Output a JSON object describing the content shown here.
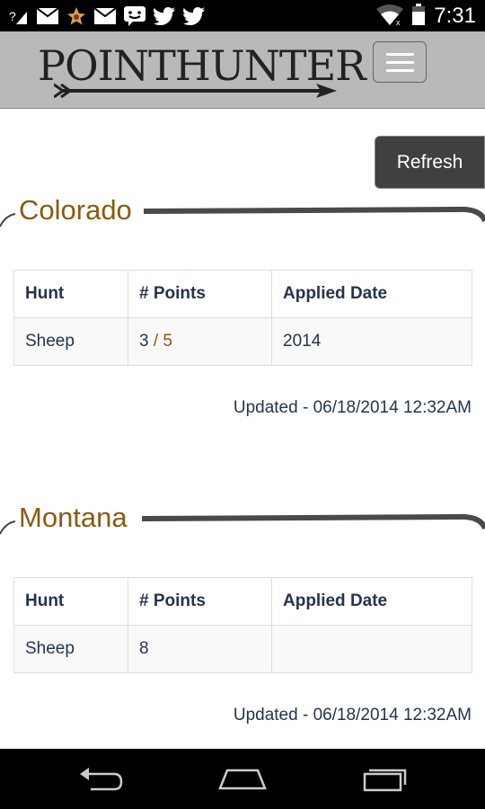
{
  "status_bar": {
    "time": "7:31",
    "left_icons": [
      "unknown-notification-icon",
      "email-icon",
      "star-badge-icon",
      "email-icon",
      "messaging-icon",
      "twitter-icon",
      "twitter-icon"
    ],
    "right_icons": [
      "wifi-icon",
      "battery-icon"
    ]
  },
  "header": {
    "logo_text": "POINTHUNTER",
    "menu_icon": "hamburger-icon"
  },
  "toolbar": {
    "refresh_label": "Refresh"
  },
  "sections": [
    {
      "state": "Colorado",
      "columns": [
        "Hunt",
        "# Points",
        "Applied Date"
      ],
      "row": {
        "hunt": "Sheep",
        "points": "3",
        "points_separator": " / ",
        "points_max": "5",
        "applied_date": "2014"
      },
      "updated": "Updated - 06/18/2014 12:32AM"
    },
    {
      "state": "Montana",
      "columns": [
        "Hunt",
        "# Points",
        "Applied Date"
      ],
      "row": {
        "hunt": "Sheep",
        "points": "8",
        "points_separator": "",
        "points_max": "",
        "applied_date": ""
      },
      "updated": "Updated - 06/18/2014 12:32AM"
    }
  ],
  "nav_bar": {
    "buttons": [
      "back-icon",
      "home-icon",
      "recent-apps-icon"
    ]
  },
  "colors": {
    "accent": "#8a5b10",
    "text": "#24344d",
    "header_bg": "#b9b9b9",
    "button_bg": "#404040"
  }
}
